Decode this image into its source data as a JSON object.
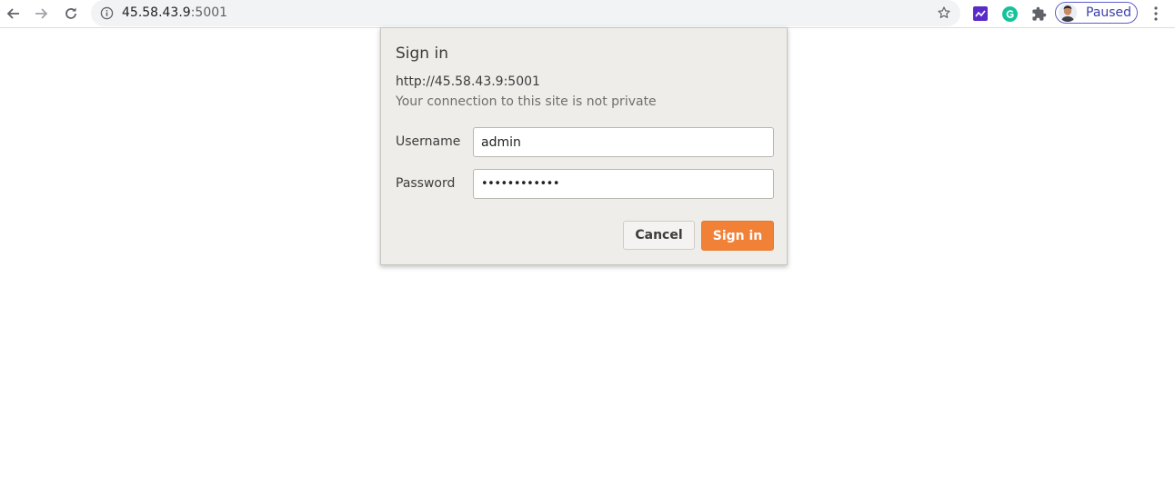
{
  "browser": {
    "url_host": "45.58.43.9",
    "url_port": ":5001",
    "profile_label": "Paused",
    "icons": {
      "back": "arrow-left-icon",
      "forward": "arrow-right-icon",
      "reload": "reload-icon",
      "site_info": "info-icon",
      "bookmark": "star-icon",
      "extension_1": "chart-extension-icon",
      "extension_2": "grammarly-icon",
      "extensions": "puzzle-icon",
      "menu": "kebab-menu-icon"
    },
    "colors": {
      "profile_accent": "#3b3fa8",
      "grammarly": "#15c39a",
      "chart_ext": "#5a2bc8"
    }
  },
  "dialog": {
    "title": "Sign in",
    "origin": "http://45.58.43.9:5001",
    "note": "Your connection to this site is not private",
    "username": {
      "label": "Username",
      "value": "admin"
    },
    "password": {
      "label": "Password",
      "value": "••••••••••••"
    },
    "cancel_label": "Cancel",
    "signin_label": "Sign in",
    "colors": {
      "primary": "#f08137",
      "background": "#efedea"
    }
  }
}
